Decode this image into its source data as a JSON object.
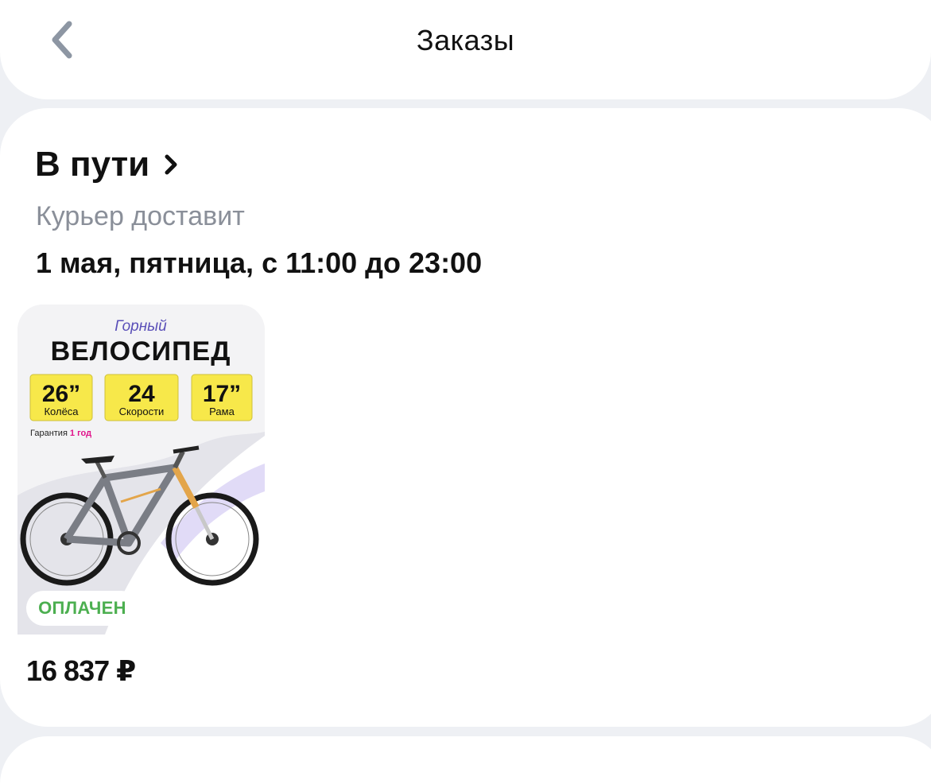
{
  "header": {
    "title": "Заказы",
    "back_icon": "chevron-left-icon"
  },
  "order": {
    "status": "В пути",
    "status_icon": "chevron-right-icon",
    "courier_label": "Курьер доставит",
    "delivery_time": "1 мая, пятница, с 11:00 до 23:00",
    "payment_badge": "ОПЛАЧЕН",
    "price": "16 837 ₽",
    "product_image": {
      "subtitle": "Горный",
      "title": "ВЕЛОСИПЕД",
      "specs": [
        {
          "value": "26”",
          "label": "Колёса"
        },
        {
          "value": "24",
          "label": "Скорости"
        },
        {
          "value": "17”",
          "label": "Рама"
        }
      ],
      "warranty_prefix": "Гарантия",
      "warranty_value": "1 год"
    }
  },
  "colors": {
    "background": "#eef0f4",
    "card": "#ffffff",
    "muted_text": "#8a8f99",
    "paid_green": "#4caf50",
    "spec_yellow": "#f7e84a",
    "warranty_pink": "#e0128a"
  }
}
